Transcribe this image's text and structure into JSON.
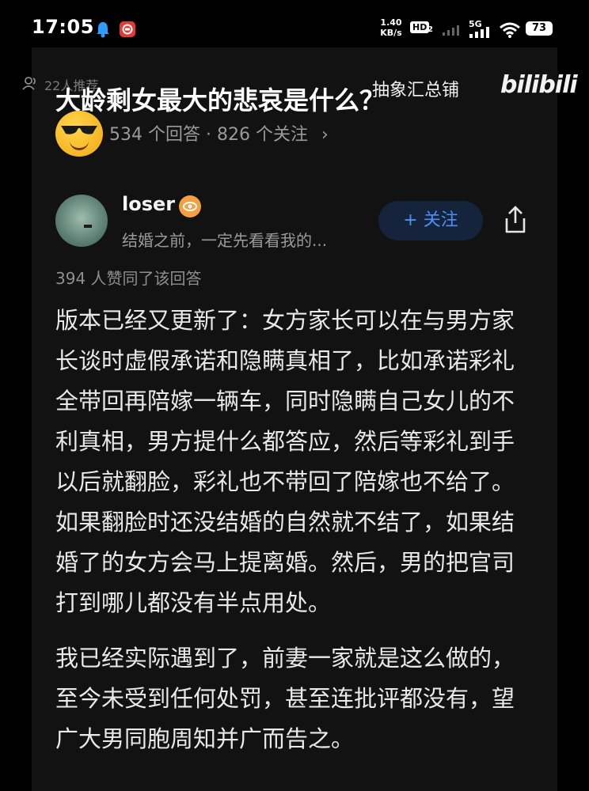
{
  "status_bar": {
    "time": "17:05",
    "net_speed_value": "1.40",
    "net_speed_unit": "KB/s",
    "hd_badge": "HD",
    "hd_sub": "2",
    "network_type": "5G",
    "battery": "73"
  },
  "watermark": {
    "users_count": "22人推荐",
    "channel_name": "抽象汇总铺",
    "logo_text": "bilibili"
  },
  "question": {
    "title": "大龄剩女最大的悲哀是什么？",
    "stats": "534 个回答 · 826 个关注",
    "chevron": "›"
  },
  "author": {
    "name": "loser",
    "bio": "结婚之前，一定先看看我的...",
    "follow_label": "+ 关注"
  },
  "answer": {
    "likes": "394 人赞同了该回答",
    "paragraph1": "版本已经又更新了：女方家长可以在与男方家长谈时虚假承诺和隐瞒真相了，比如承诺彩礼全带回再陪嫁一辆车，同时隐瞒自己女儿的不利真相，男方提什么都答应，然后等彩礼到手以后就翻脸，彩礼也不带回了陪嫁也不给了。如果翻脸时还没结婚的自然就不结了，如果结婚了的女方会马上提离婚。然后，男的把官司打到哪儿都没有半点用处。",
    "paragraph2": "我已经实际遇到了，前妻一家就是这么做的，至今未受到任何处罚，甚至连批评都没有，望广大男同胞周知并广而告之。"
  },
  "colors": {
    "background": "#121212",
    "accent_blue": "#4f8ef7",
    "badge_orange": "#f3a043"
  }
}
